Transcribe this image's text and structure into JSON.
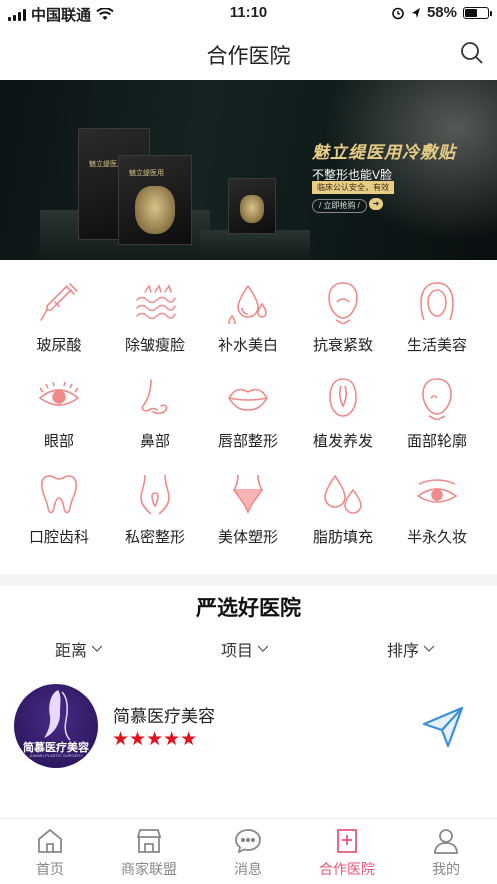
{
  "status": {
    "carrier": "中国联通",
    "time": "11:10",
    "battery": "58%",
    "battery_level": 0.58
  },
  "header": {
    "title": "合作医院",
    "search_icon": "search-icon"
  },
  "banner": {
    "box_label": "魅立缇医用",
    "title": "魅立缇医用冷敷贴",
    "subtitle": "不整形也能V脸",
    "tag": "临床公认安全，有效",
    "cta": "/ 立即抢购 /"
  },
  "categories": [
    {
      "label": "玻尿酸",
      "icon": "syringe-dropper-icon"
    },
    {
      "label": "除皱瘦脸",
      "icon": "wrinkle-waves-icon"
    },
    {
      "label": "补水美白",
      "icon": "water-drop-icon"
    },
    {
      "label": "抗衰紧致",
      "icon": "face-lift-icon"
    },
    {
      "label": "生活美容",
      "icon": "woman-face-icon"
    },
    {
      "label": "眼部",
      "icon": "eye-icon"
    },
    {
      "label": "鼻部",
      "icon": "nose-icon"
    },
    {
      "label": "唇部整形",
      "icon": "lips-icon"
    },
    {
      "label": "植发养发",
      "icon": "hair-follicle-icon"
    },
    {
      "label": "面部轮廓",
      "icon": "face-contour-icon"
    },
    {
      "label": "口腔齿科",
      "icon": "tooth-icon"
    },
    {
      "label": "私密整形",
      "icon": "private-body-icon"
    },
    {
      "label": "美体塑形",
      "icon": "body-shaping-icon"
    },
    {
      "label": "脂肪填充",
      "icon": "fat-drops-icon"
    },
    {
      "label": "半永久妆",
      "icon": "eyeliner-eye-icon"
    }
  ],
  "section": {
    "title": "严选好医院"
  },
  "filters": [
    {
      "label": "距离"
    },
    {
      "label": "项目"
    },
    {
      "label": "排序"
    }
  ],
  "hospital": {
    "name": "简慕医疗美容",
    "logo_text": "简慕医疗美容",
    "logo_sub": "JIANMU PLASTIC SURGERY",
    "stars": "★★★★★",
    "rating": 5
  },
  "tabs": [
    {
      "label": "首页",
      "icon": "home-icon"
    },
    {
      "label": "商家联盟",
      "icon": "shop-icon"
    },
    {
      "label": "消息",
      "icon": "chat-bubble-icon"
    },
    {
      "label": "合作医院",
      "icon": "hospital-icon",
      "active": true
    },
    {
      "label": "我的",
      "icon": "user-icon"
    }
  ],
  "colors": {
    "accent": "#e8577c",
    "icon_pink": "#f08a8a",
    "star_red": "#e3101d"
  }
}
